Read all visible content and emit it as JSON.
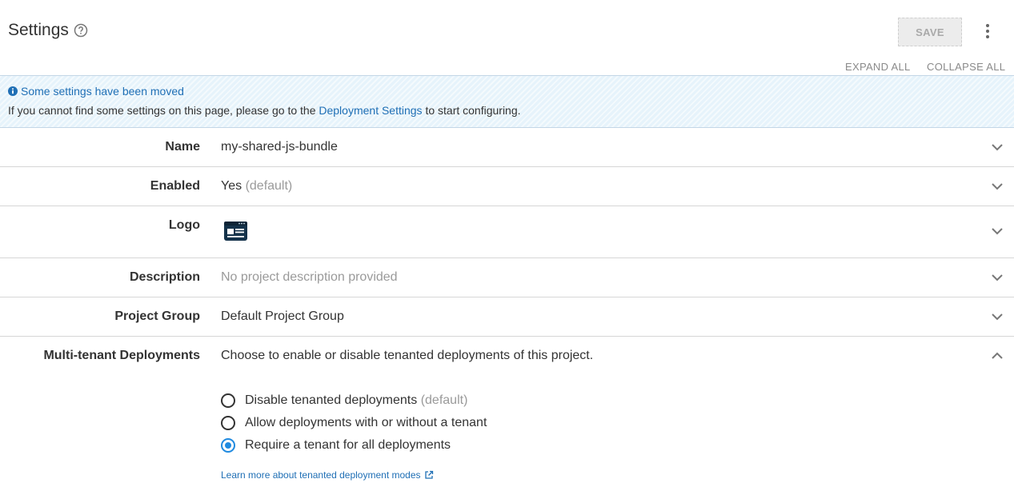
{
  "header": {
    "title": "Settings",
    "save_label": "SAVE",
    "expand_all": "EXPAND ALL",
    "collapse_all": "COLLAPSE ALL"
  },
  "callout": {
    "title": "Some settings have been moved",
    "text_before": "If you cannot find some settings on this page, please go to the ",
    "link": "Deployment Settings",
    "text_after": " to start configuring."
  },
  "rows": {
    "name": {
      "label": "Name",
      "value": "my-shared-js-bundle"
    },
    "enabled": {
      "label": "Enabled",
      "value": "Yes",
      "suffix": "(default)"
    },
    "logo": {
      "label": "Logo"
    },
    "description": {
      "label": "Description",
      "value": "No project description provided"
    },
    "project_group": {
      "label": "Project Group",
      "value": "Default Project Group"
    },
    "multi_tenant": {
      "label": "Multi-tenant Deployments",
      "value": "Choose to enable or disable tenanted deployments of this project."
    }
  },
  "tenant_options": [
    {
      "label": "Disable tenanted deployments",
      "suffix": "(default)",
      "selected": false
    },
    {
      "label": "Allow deployments with or without a tenant",
      "suffix": "",
      "selected": false
    },
    {
      "label": "Require a tenant for all deployments",
      "suffix": "",
      "selected": true
    }
  ],
  "learn_more": "Learn more about tenanted deployment modes",
  "colors": {
    "accent": "#1f8ae0",
    "link": "#1f6fb5",
    "callout_bg": "#e6f3fb"
  }
}
